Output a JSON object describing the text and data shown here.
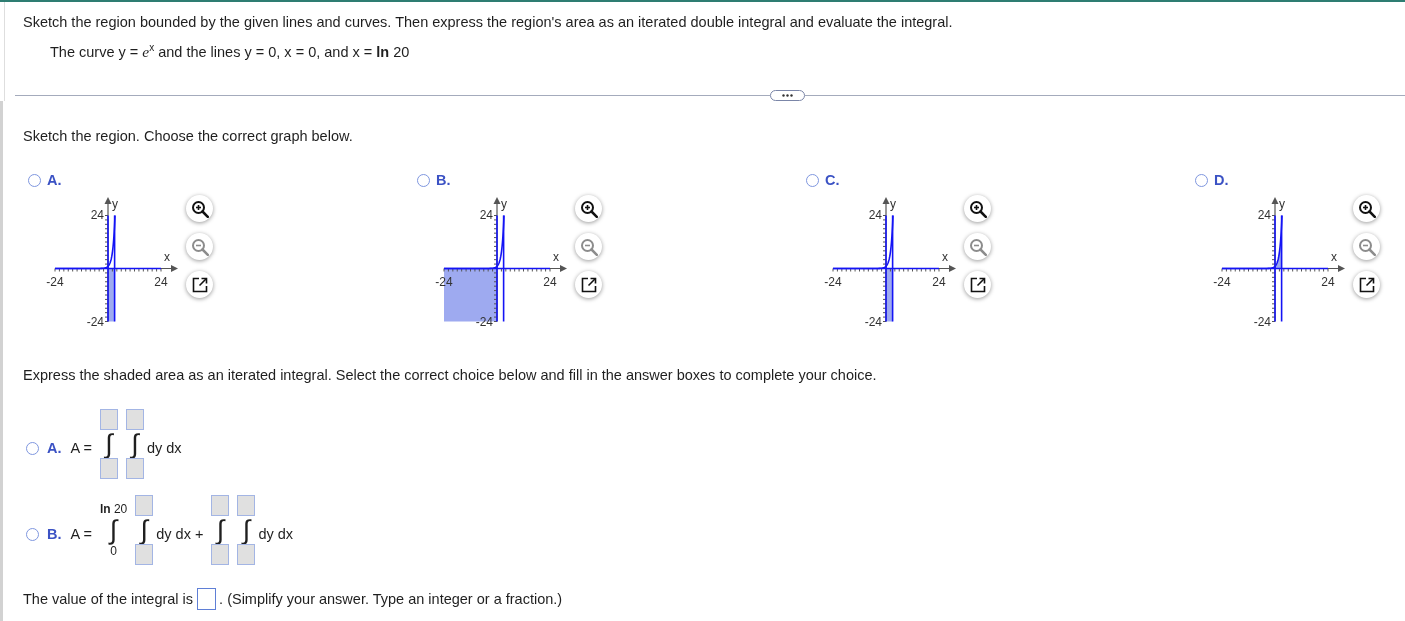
{
  "question": {
    "instruction": "Sketch the region bounded by the given lines and curves. Then express the region's area as an iterated double integral and evaluate the integral.",
    "given": "The curve y = *e*$^{x}$ and the lines y = 0, x = 0, and x = **ln** 20"
  },
  "sketch": {
    "prompt": "Sketch the region. Choose the correct graph below.",
    "choices": [
      {
        "letter": "A.",
        "selected": false,
        "kind": "strip-below",
        "axes": {
          "x_label": "x",
          "y_label": "y",
          "x_min": "-24",
          "x_max": "24",
          "y_min": "-24",
          "y_max": "24"
        },
        "tools": [
          {
            "kind": "zoom-in",
            "disabled": false
          },
          {
            "kind": "zoom-out",
            "disabled": true
          },
          {
            "kind": "popout",
            "disabled": false
          }
        ]
      },
      {
        "letter": "B.",
        "selected": false,
        "kind": "third-quadrant",
        "axes": {
          "x_label": "x",
          "y_label": "y",
          "x_min": "-24",
          "x_max": "24",
          "y_min": "-24",
          "y_max": "24"
        },
        "tools": [
          {
            "kind": "zoom-in",
            "disabled": false
          },
          {
            "kind": "zoom-out",
            "disabled": true
          },
          {
            "kind": "popout",
            "disabled": false
          }
        ]
      },
      {
        "letter": "C.",
        "selected": false,
        "kind": "strip-below",
        "axes": {
          "x_label": "x",
          "y_label": "y",
          "x_min": "-24",
          "x_max": "24",
          "y_min": "-24",
          "y_max": "24"
        },
        "tools": [
          {
            "kind": "zoom-in",
            "disabled": false
          },
          {
            "kind": "zoom-out",
            "disabled": true
          },
          {
            "kind": "popout",
            "disabled": false
          }
        ]
      },
      {
        "letter": "D.",
        "selected": false,
        "kind": "under-curve",
        "axes": {
          "x_label": "x",
          "y_label": "y",
          "x_min": "-24",
          "x_max": "24",
          "y_min": "-24",
          "y_max": "24"
        },
        "tools": [
          {
            "kind": "zoom-in",
            "disabled": false
          },
          {
            "kind": "zoom-out",
            "disabled": true
          },
          {
            "kind": "popout",
            "disabled": false
          }
        ]
      }
    ]
  },
  "integral": {
    "prompt": "Express the shaded area as an iterated integral. Select the correct choice below and fill in the answer boxes to complete your choice.",
    "choices": [
      {
        "letter": "A.",
        "selected": false,
        "lhs": "A =",
        "terms": [
          {
            "kind": "integral",
            "sign": "∫",
            "upper": {
              "kind": "box"
            },
            "lower": {
              "kind": "box"
            }
          },
          {
            "kind": "integral",
            "sign": "∫",
            "upper": {
              "kind": "box"
            },
            "lower": {
              "kind": "box"
            }
          },
          {
            "kind": "text",
            "text": "dy dx"
          }
        ]
      },
      {
        "letter": "B.",
        "selected": false,
        "lhs": "A =",
        "terms": [
          {
            "kind": "integral",
            "sign": "∫",
            "upper": {
              "kind": "text",
              "text": "**ln** 20"
            },
            "lower": {
              "kind": "text",
              "text": "0"
            }
          },
          {
            "kind": "integral",
            "sign": "∫",
            "upper": {
              "kind": "box"
            },
            "lower": {
              "kind": "box"
            }
          },
          {
            "kind": "text",
            "text": "dy dx +"
          },
          {
            "kind": "integral",
            "sign": "∫",
            "upper": {
              "kind": "box"
            },
            "lower": {
              "kind": "box"
            }
          },
          {
            "kind": "integral",
            "sign": "∫",
            "upper": {
              "kind": "box"
            },
            "lower": {
              "kind": "box"
            }
          },
          {
            "kind": "text",
            "text": "dy dx"
          }
        ]
      }
    ]
  },
  "result": {
    "before": "The value of the integral is",
    "answer": {
      "kind": "box"
    },
    "after": ". (Simplify your answer. Type an integer or a fraction.)"
  }
}
